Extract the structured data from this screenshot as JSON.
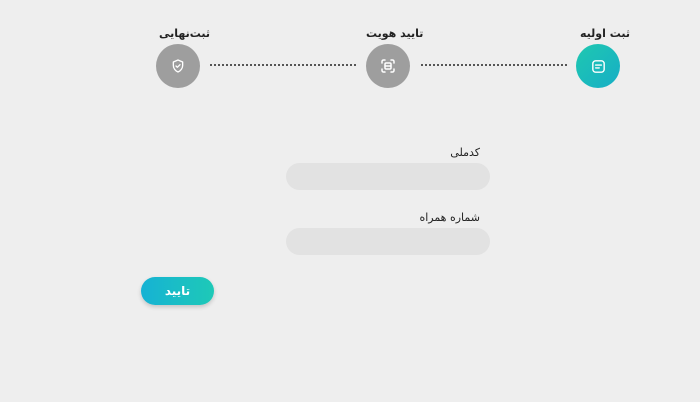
{
  "stepper": {
    "steps": [
      {
        "label": "ثبت اولیه",
        "icon": "note-icon",
        "state": "active"
      },
      {
        "label": "تایید هویت",
        "icon": "scan-icon",
        "state": "inactive"
      },
      {
        "label": "ثبت‌نهایی",
        "icon": "shield-check-icon",
        "state": "inactive"
      }
    ]
  },
  "form": {
    "national_code": {
      "label": "کدملی",
      "value": "",
      "placeholder": ""
    },
    "mobile": {
      "label": "شماره همراه",
      "value": "",
      "placeholder": ""
    },
    "submit_label": "تایید"
  },
  "colors": {
    "active_step_gradient": [
      "#1fc8b0",
      "#16aec6"
    ],
    "inactive_step": "#9e9e9e",
    "button_gradient": [
      "#16b2d4",
      "#1ec9b7"
    ],
    "background": "#eeeeee",
    "input_background": "#e2e2e2"
  }
}
